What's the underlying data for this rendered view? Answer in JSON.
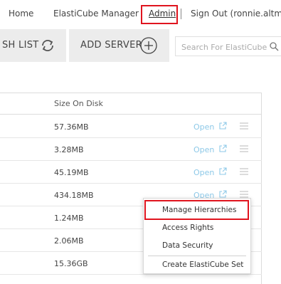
{
  "nav": {
    "home": "Home",
    "elasticube_manager": "ElastiCube Manager",
    "admin": "Admin",
    "sign_out": "Sign Out (ronnie.altman"
  },
  "toolbar": {
    "refresh_list_label": "SH LIST",
    "add_server_label": "ADD SERVER",
    "search_placeholder": "Search For ElastiCubes"
  },
  "table": {
    "column_header": "Size On Disk",
    "open_label": "Open",
    "rows": [
      {
        "size": "57.36MB",
        "has_open": true
      },
      {
        "size": "3.28MB",
        "has_open": true
      },
      {
        "size": "45.19MB",
        "has_open": true
      },
      {
        "size": "434.18MB",
        "has_open": true
      },
      {
        "size": "1.24MB",
        "has_open": false
      },
      {
        "size": "2.06MB",
        "has_open": false
      },
      {
        "size": "15.36GB",
        "has_open": false
      }
    ]
  },
  "context_menu": {
    "items": [
      "Manage Hierarchies",
      "Access Rights",
      "Data Security",
      "Create ElastiCube Set"
    ]
  },
  "colors": {
    "highlight": "#e0141e",
    "link": "#8ec9e8",
    "toolbar_bg": "#ececec"
  }
}
